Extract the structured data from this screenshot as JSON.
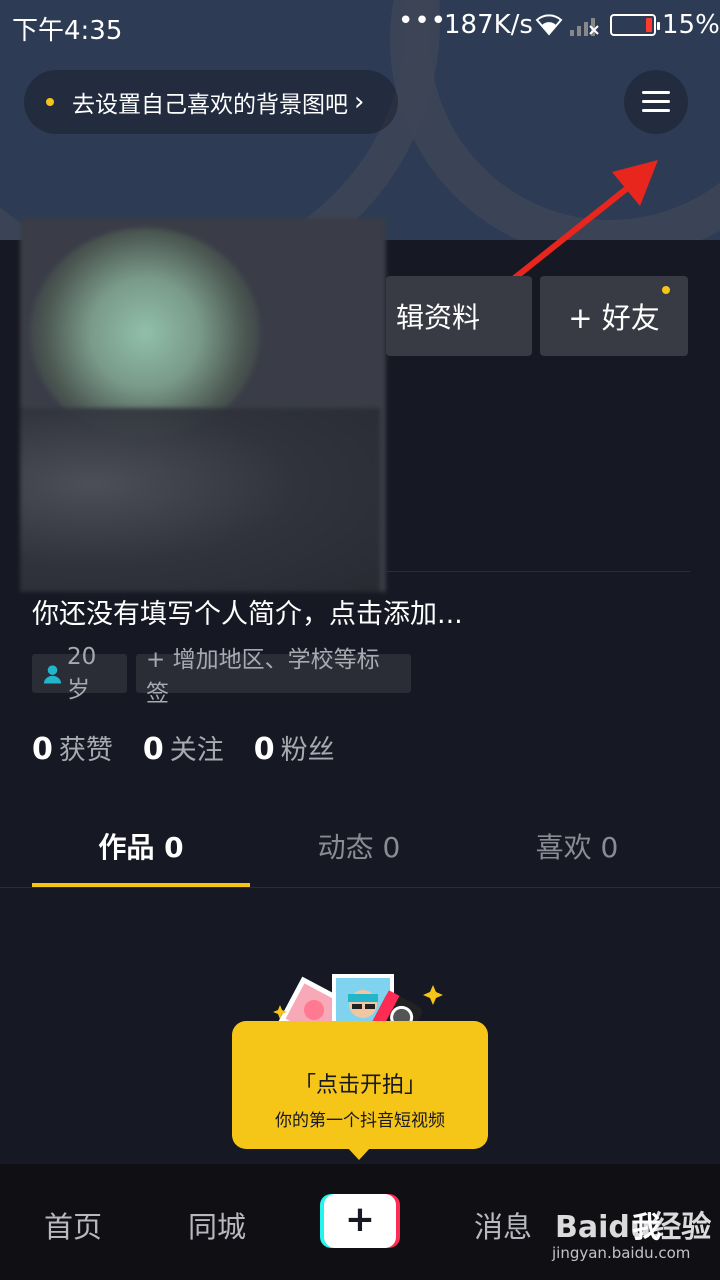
{
  "status_bar": {
    "time": "下午4:35",
    "dots": "•••",
    "net_speed": "187K/s",
    "battery_pct": "15%",
    "battery_level": 0.15
  },
  "header": {
    "bg_prompt": "去设置自己喜欢的背景图吧",
    "bg_prompt_arrow": "›",
    "menu_icon": "hamburger-menu-icon",
    "annotation_arrow_color": "#e8261e"
  },
  "profile": {
    "edit_label": "编辑资料",
    "edit_visible": "辑资料",
    "add_friend": "+ 好友",
    "bio": "你还没有填写个人简介，点击添加...",
    "tags": {
      "age": "20岁",
      "add_tag": "+ 增加地区、学校等标签"
    },
    "stats": [
      {
        "value": "0",
        "label": "获赞"
      },
      {
        "value": "0",
        "label": "关注"
      },
      {
        "value": "0",
        "label": "粉丝"
      }
    ]
  },
  "tabs": [
    {
      "label": "作品 0",
      "active": true
    },
    {
      "label": "动态 0",
      "active": false
    },
    {
      "label": "喜欢 0",
      "active": false
    }
  ],
  "cta": {
    "title": "「点击开拍」",
    "subtitle": "你的第一个抖音短视频"
  },
  "bottom_nav": {
    "home": "首页",
    "nearby": "同城",
    "create": "+",
    "messages": "消息",
    "me": "我"
  },
  "watermark": {
    "logo": "Baidu经验",
    "url": "jingyan.baidu.com"
  },
  "colors": {
    "accent": "#f5c518",
    "background": "#161823",
    "header_bg": "#2d3c54",
    "tiktok_cyan": "#25f4ee",
    "tiktok_red": "#fe2c55"
  }
}
